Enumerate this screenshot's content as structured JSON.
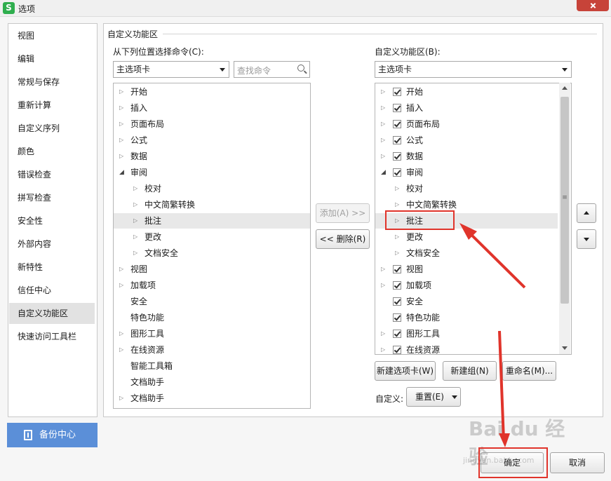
{
  "window": {
    "title": "选项",
    "app_icon": "S"
  },
  "nav": {
    "items": [
      "视图",
      "编辑",
      "常规与保存",
      "重新计算",
      "自定义序列",
      "颜色",
      "错误检查",
      "拼写检查",
      "安全性",
      "外部内容",
      "新特性",
      "信任中心",
      "自定义功能区",
      "快速访问工具栏"
    ],
    "active": "自定义功能区",
    "backup_label": "备份中心"
  },
  "group": {
    "title": "自定义功能区"
  },
  "left": {
    "label": "从下列位置选择命令(C):",
    "dropdown_value": "主选项卡",
    "search_placeholder": "查找命令",
    "tree": [
      {
        "label": "开始",
        "expander": "collapsed",
        "level": 0
      },
      {
        "label": "插入",
        "expander": "collapsed",
        "level": 0
      },
      {
        "label": "页面布局",
        "expander": "collapsed",
        "level": 0
      },
      {
        "label": "公式",
        "expander": "collapsed",
        "level": 0
      },
      {
        "label": "数据",
        "expander": "collapsed",
        "level": 0
      },
      {
        "label": "审阅",
        "expander": "expanded",
        "level": 0
      },
      {
        "label": "校对",
        "expander": "collapsed",
        "level": 1
      },
      {
        "label": "中文简繁转换",
        "expander": "collapsed",
        "level": 1
      },
      {
        "label": "批注",
        "expander": "collapsed",
        "level": 1,
        "selected": true
      },
      {
        "label": "更改",
        "expander": "collapsed",
        "level": 1
      },
      {
        "label": "文档安全",
        "expander": "collapsed",
        "level": 1
      },
      {
        "label": "视图",
        "expander": "collapsed",
        "level": 0
      },
      {
        "label": "加载项",
        "expander": "collapsed",
        "level": 0
      },
      {
        "label": "安全",
        "expander": "none",
        "level": 0
      },
      {
        "label": "特色功能",
        "expander": "none",
        "level": 0
      },
      {
        "label": "图形工具",
        "expander": "collapsed",
        "level": 0
      },
      {
        "label": "在线资源",
        "expander": "collapsed",
        "level": 0
      },
      {
        "label": "智能工具箱",
        "expander": "none",
        "level": 0
      },
      {
        "label": "文档助手",
        "expander": "none",
        "level": 0
      },
      {
        "label": "文档助手",
        "expander": "collapsed",
        "level": 0
      }
    ]
  },
  "middle": {
    "add_label": "添加(A) >>",
    "remove_label": "<< 删除(R)"
  },
  "right": {
    "label": "自定义功能区(B):",
    "dropdown_value": "主选项卡",
    "tree": [
      {
        "label": "开始",
        "expander": "collapsed",
        "level": 0,
        "checked": true
      },
      {
        "label": "插入",
        "expander": "collapsed",
        "level": 0,
        "checked": true
      },
      {
        "label": "页面布局",
        "expander": "collapsed",
        "level": 0,
        "checked": true
      },
      {
        "label": "公式",
        "expander": "collapsed",
        "level": 0,
        "checked": true
      },
      {
        "label": "数据",
        "expander": "collapsed",
        "level": 0,
        "checked": true
      },
      {
        "label": "审阅",
        "expander": "expanded",
        "level": 0,
        "checked": true
      },
      {
        "label": "校对",
        "expander": "collapsed",
        "level": 1
      },
      {
        "label": "中文简繁转换",
        "expander": "collapsed",
        "level": 1
      },
      {
        "label": "批注",
        "expander": "collapsed",
        "level": 1,
        "selected": true
      },
      {
        "label": "更改",
        "expander": "collapsed",
        "level": 1
      },
      {
        "label": "文档安全",
        "expander": "collapsed",
        "level": 1
      },
      {
        "label": "视图",
        "expander": "collapsed",
        "level": 0,
        "checked": true
      },
      {
        "label": "加载项",
        "expander": "collapsed",
        "level": 0,
        "checked": true
      },
      {
        "label": "安全",
        "expander": "none",
        "level": 0,
        "checked": true
      },
      {
        "label": "特色功能",
        "expander": "none",
        "level": 0,
        "checked": true
      },
      {
        "label": "图形工具",
        "expander": "collapsed",
        "level": 0,
        "checked": true
      },
      {
        "label": "在线资源",
        "expander": "collapsed",
        "level": 0,
        "checked": true
      }
    ],
    "new_tab_label": "新建选项卡(W)",
    "new_group_label": "新建组(N)",
    "rename_label": "重命名(M)...",
    "customize_label": "自定义:",
    "reset_label": "重置(E)"
  },
  "footer": {
    "ok_label": "确定",
    "cancel_label": "取消"
  },
  "watermark": {
    "text": "Bai du 经验",
    "url": "jingyan.baidu.com"
  },
  "colors": {
    "accent": "#5b8fd8",
    "highlight": "#e0342b",
    "title_close": "#c74339"
  }
}
